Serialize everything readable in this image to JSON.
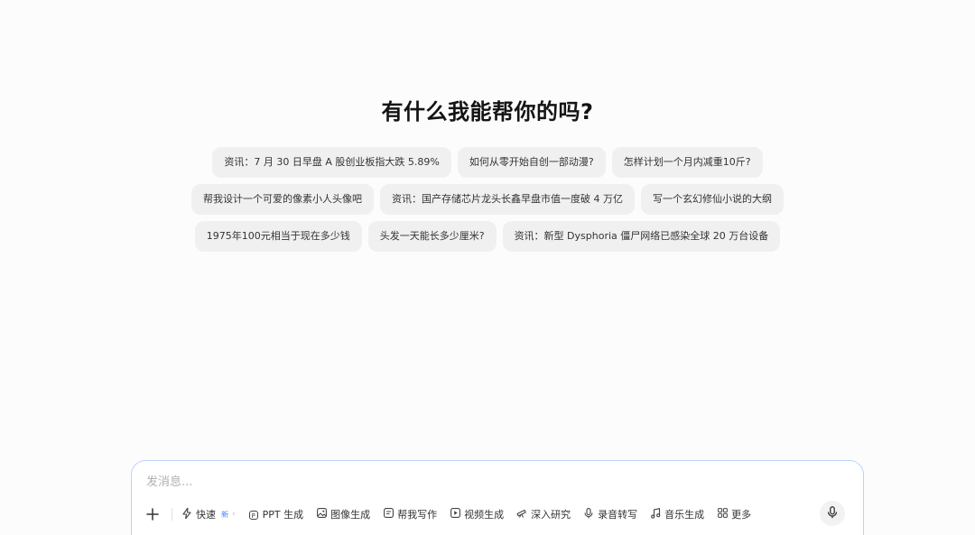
{
  "heading": "有什么我能帮你的吗?",
  "suggestions": {
    "row1": [
      "资讯：7 月 30 日早盘 A 股创业板指大跌 5.89%",
      "如何从零开始自创一部动漫?",
      "怎样计划一个月内减重10斤?"
    ],
    "row2": [
      "帮我设计一个可爱的像素小人头像吧",
      "资讯：国产存储芯片龙头长鑫早盘市值一度破 4 万亿",
      "写一个玄幻修仙小说的大纲"
    ],
    "row3": [
      "1975年100元相当于现在多少钱",
      "头发一天能长多少厘米?",
      "资讯：新型 Dysphoria 僵尸网络已感染全球 20 万台设备"
    ]
  },
  "composer": {
    "placeholder": "发消息...",
    "tools": {
      "fast": "快速",
      "fast_badge": "新",
      "ppt": "PPT 生成",
      "image": "图像生成",
      "write": "帮我写作",
      "video": "视频生成",
      "research": "深入研究",
      "transcribe": "录音转写",
      "music": "音乐生成",
      "more": "更多"
    }
  },
  "icons": {
    "plus": "plus-icon",
    "fast": "lightning-icon",
    "ppt": "ppt-icon",
    "image": "image-icon",
    "write": "document-icon",
    "video": "video-icon",
    "research": "telescope-icon",
    "transcribe": "mic-icon",
    "music": "music-note-icon",
    "more": "grid-icon",
    "voice": "mic-icon"
  },
  "colors": {
    "accent": "#3b82f6",
    "chip_bg": "#f0f0f0",
    "composer_border": "#bcd3f7"
  }
}
